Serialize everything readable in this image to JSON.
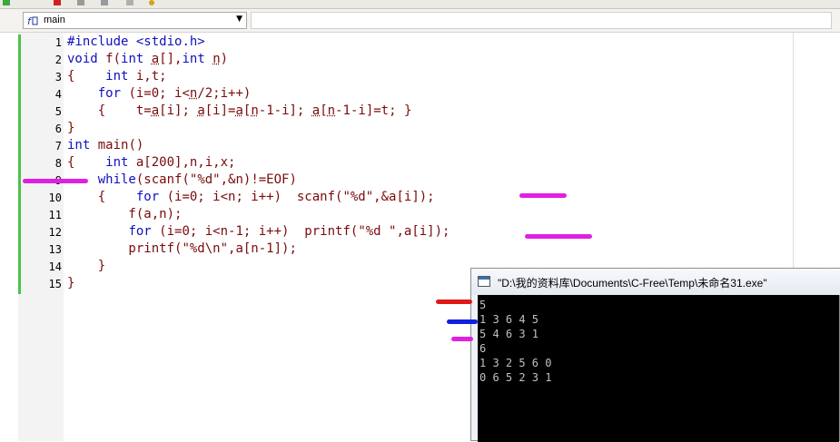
{
  "function_bar": {
    "selected_function": "main"
  },
  "editor": {
    "line_numbers": [
      "1",
      "2",
      "3",
      "4",
      "5",
      "6",
      "7",
      "8",
      "9",
      "10",
      "11",
      "12",
      "13",
      "14",
      "15"
    ]
  },
  "console": {
    "title": "\"D:\\我的资料库\\Documents\\C-Free\\Temp\\未命名31.exe\"",
    "output": [
      "5",
      "1 3 6 4 5",
      "5 4 6 3 1",
      "6",
      "1 3 2 5 6 0",
      "0 6 5 2 3 1"
    ]
  },
  "annotation_colors": {
    "magenta": "#e020e0",
    "red": "#e01818",
    "blue": "#1020e0",
    "green": "#4cc24c",
    "keyword": "#1010c0",
    "text": "#7a0a0a"
  }
}
